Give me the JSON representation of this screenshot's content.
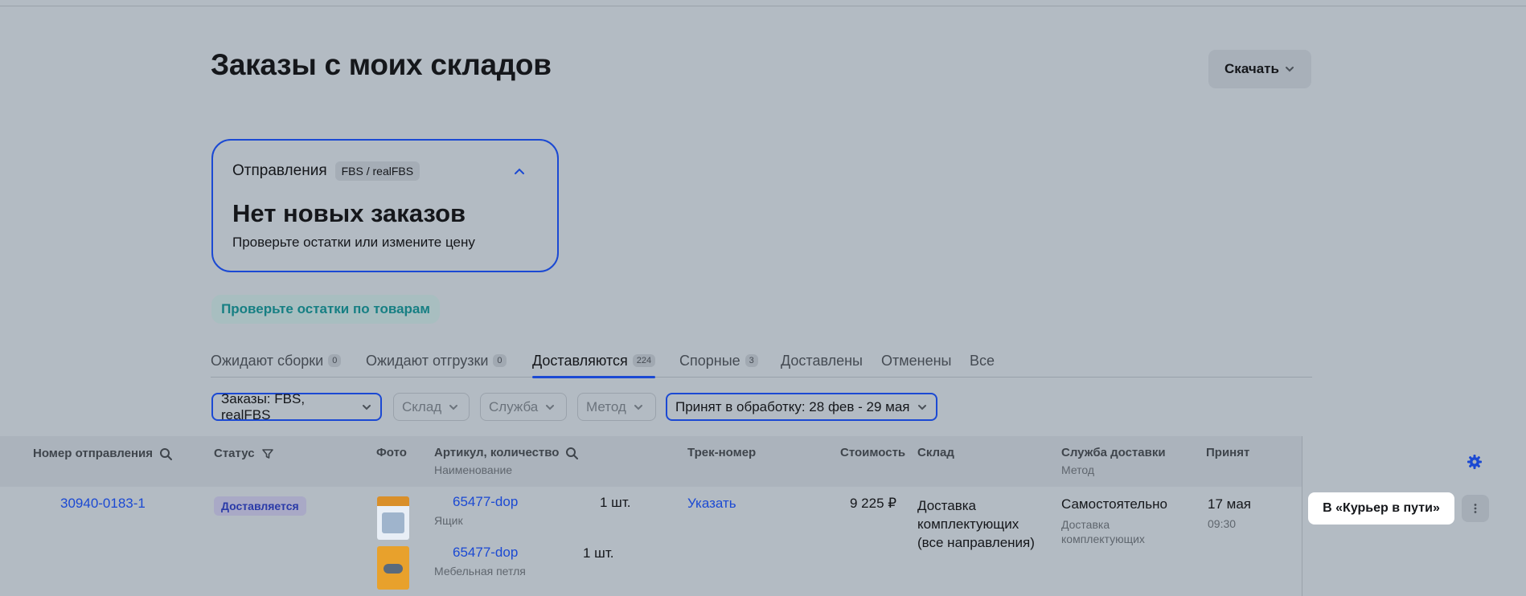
{
  "header": {
    "title": "Заказы с моих складов",
    "download_label": "Скачать"
  },
  "shipments": {
    "title": "Отправления",
    "badge": "FBS / realFBS",
    "headline": "Нет новых заказов",
    "subtitle": "Проверьте остатки или измените цену"
  },
  "stock_check_label": "Проверьте остатки по товарам",
  "tabs": [
    {
      "label": "Ожидают сборки",
      "count": "0"
    },
    {
      "label": "Ожидают отгрузки",
      "count": "0"
    },
    {
      "label": "Доставляются",
      "count": "224"
    },
    {
      "label": "Спорные",
      "count": "3"
    },
    {
      "label": "Доставлены",
      "count": ""
    },
    {
      "label": "Отменены",
      "count": ""
    },
    {
      "label": "Все",
      "count": ""
    }
  ],
  "active_tab": "Доставляются",
  "filters": [
    {
      "label": "Заказы: FBS, realFBS"
    },
    {
      "label": "Склад"
    },
    {
      "label": "Служба"
    },
    {
      "label": "Метод"
    },
    {
      "label": "Принят в обработку: 28 фев - 29 мая"
    }
  ],
  "table": {
    "headers": {
      "shipment_number": "Номер отправления",
      "status": "Статус",
      "photo": "Фото",
      "article": "Артикул, количество",
      "article_sub": "Наименование",
      "track": "Трек-номер",
      "cost": "Стоимость",
      "warehouse": "Склад",
      "delivery": "Служба доставки",
      "delivery_sub": "Метод",
      "accepted": "Принят"
    },
    "rows": [
      {
        "shipment_number": "30940-0183-1",
        "status": "Доставляется",
        "items": [
          {
            "article": "65477-dop",
            "qty": "1 шт.",
            "name": "Ящик"
          },
          {
            "article": "65477-dop",
            "qty": "1 шт.",
            "name": "Мебельная петля"
          }
        ],
        "track": "Указать",
        "cost": "9 225 ₽",
        "warehouse": "Доставка комплектующих (все направления)",
        "delivery_service": "Самостоятельно",
        "delivery_method": "Доставка комплектующих",
        "accepted_date": "17 мая",
        "accepted_time": "09:30",
        "action_label": "В «Курьер в пути»"
      }
    ]
  },
  "colors": {
    "accent": "#1b49d3",
    "teal": "#167f83",
    "background": "#b3bbc3"
  }
}
